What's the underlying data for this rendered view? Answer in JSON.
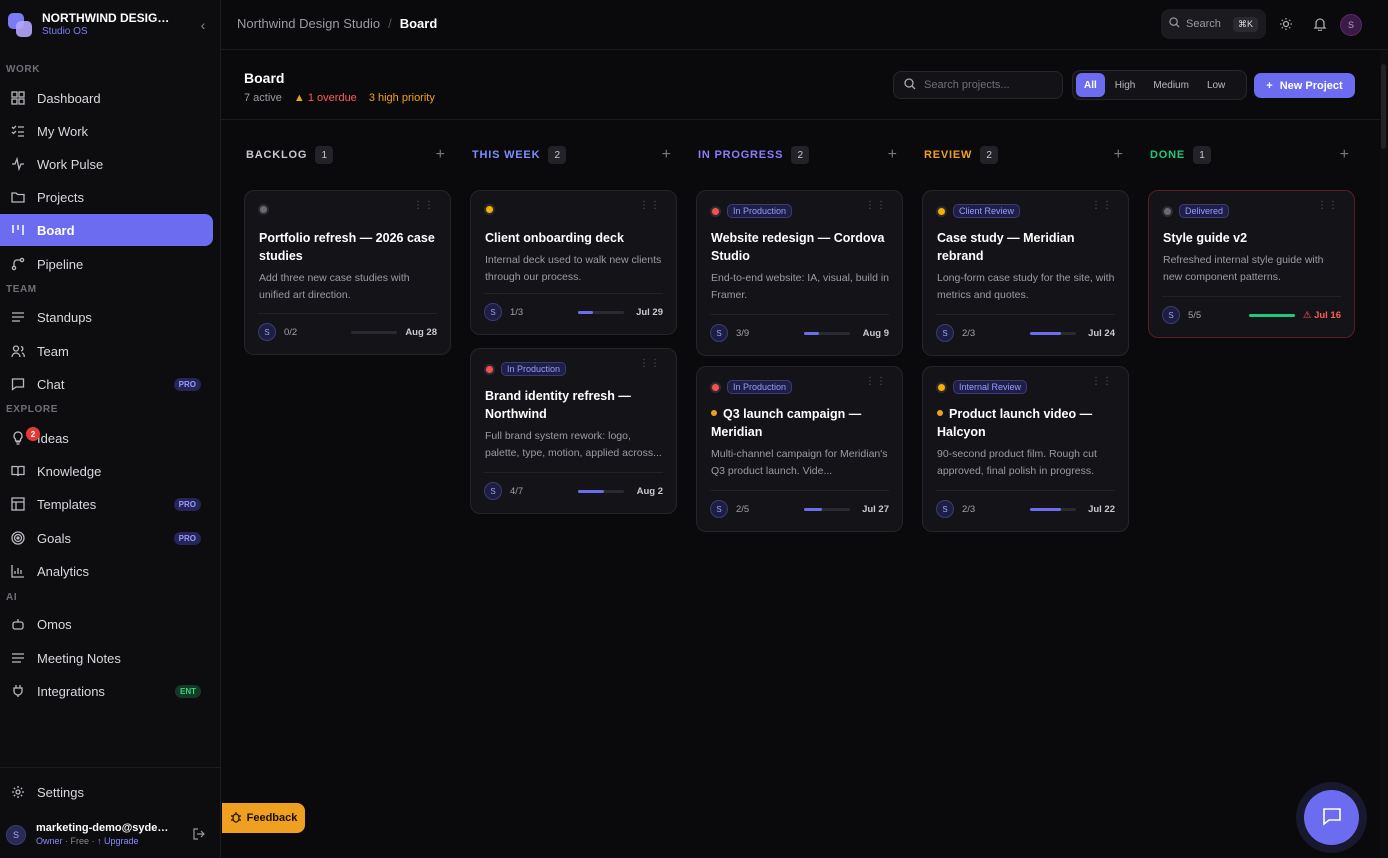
{
  "brand": {
    "name": "NORTHWIND DESIGN S...",
    "sub": "Studio OS"
  },
  "sidebar": {
    "sections": {
      "work": "WORK",
      "team": "TEAM",
      "explore": "EXPLORE",
      "ai": "AI"
    },
    "items": [
      {
        "label": "Dashboard",
        "icon": "grid-icon"
      },
      {
        "label": "My Work",
        "icon": "list-check-icon"
      },
      {
        "label": "Work Pulse",
        "icon": "pulse-icon"
      },
      {
        "label": "Projects",
        "icon": "folder-icon"
      },
      {
        "label": "Board",
        "icon": "board-icon",
        "active": true
      },
      {
        "label": "Pipeline",
        "icon": "pipeline-icon"
      },
      {
        "label": "Standups",
        "icon": "lines-icon"
      },
      {
        "label": "Team",
        "icon": "users-icon"
      },
      {
        "label": "Chat",
        "icon": "chat-icon",
        "tag": "PRO"
      },
      {
        "label": "Ideas",
        "icon": "bulb-icon",
        "badge": "2"
      },
      {
        "label": "Knowledge",
        "icon": "book-icon"
      },
      {
        "label": "Templates",
        "icon": "template-icon",
        "tag": "PRO"
      },
      {
        "label": "Goals",
        "icon": "target-icon",
        "tag": "PRO"
      },
      {
        "label": "Analytics",
        "icon": "chart-icon"
      },
      {
        "label": "Omos",
        "icon": "bot-icon"
      },
      {
        "label": "Meeting Notes",
        "icon": "notes-icon"
      },
      {
        "label": "Integrations",
        "icon": "plug-icon",
        "tag": "ENT"
      },
      {
        "label": "Settings",
        "icon": "gear-icon"
      }
    ]
  },
  "user": {
    "email": "marketing-demo@sydenc...",
    "role": "Owner",
    "plan": "Free",
    "upgrade": "↑ Upgrade",
    "avatar": "S"
  },
  "feedback": "Feedback",
  "topbar": {
    "crumb_parent": "Northwind Design Studio",
    "crumb_sep": "/",
    "crumb_current": "Board",
    "search": "Search",
    "shortcut": "⌘K",
    "avatar": "S"
  },
  "header": {
    "title": "Board",
    "active": "7 active",
    "overdue": "1 overdue",
    "high_priority": "3 high priority",
    "search_placeholder": "Search projects...",
    "filters": [
      "All",
      "High",
      "Medium",
      "Low"
    ],
    "new_project": "New Project"
  },
  "colors": {
    "accent": "#6c6cf0",
    "backlog": "#c8c8d0",
    "this_week": "#7b8cff",
    "in_progress": "#8a7cff",
    "review": "#f0a020",
    "done": "#22c87a",
    "priority_high": "#ff4d4d",
    "priority_medium": "#f5b000",
    "priority_none": "#6a6a72"
  },
  "columns": [
    {
      "title": "BACKLOG",
      "count": "1",
      "color": "#c8c8d0",
      "cards": [
        {
          "title": "Portfolio refresh — 2026 case studies",
          "desc": "Add three new case studies with unified art direction.",
          "tasks": "0/2",
          "progress": 0,
          "date": "Aug 28",
          "priority": "none"
        }
      ]
    },
    {
      "title": "THIS WEEK",
      "count": "2",
      "color": "#7b8cff",
      "cards": [
        {
          "title": "Client onboarding deck",
          "desc": "Internal deck used to walk new clients through our process.",
          "tasks": "1/3",
          "progress": 0.33,
          "date": "Jul 29",
          "priority": "medium"
        },
        {
          "title": "Brand identity refresh — Northwind",
          "tag": "In Production",
          "desc": "Full brand system rework: logo, palette, type, motion, applied across...",
          "tasks": "4/7",
          "progress": 0.57,
          "date": "Aug 2",
          "priority": "high"
        }
      ]
    },
    {
      "title": "IN PROGRESS",
      "count": "2",
      "color": "#8a7cff",
      "cards": [
        {
          "title": "Website redesign — Cordova Studio",
          "tag": "In Production",
          "desc": "End-to-end website: IA, visual, build in Framer.",
          "tasks": "3/9",
          "progress": 0.33,
          "date": "Aug 9",
          "priority": "high"
        },
        {
          "title": "Q3 launch campaign — Meridian",
          "tag": "In Production",
          "desc": "Multi-channel campaign for Meridian's Q3 product launch. Vide...",
          "tasks": "2/5",
          "progress": 0.4,
          "date": "Jul 27",
          "priority": "high",
          "title_dot": true
        }
      ]
    },
    {
      "title": "REVIEW",
      "count": "2",
      "color": "#f0a020",
      "cards": [
        {
          "title": "Case study — Meridian rebrand",
          "tag": "Client Review",
          "desc": "Long-form case study for the site, with metrics and quotes.",
          "tasks": "2/3",
          "progress": 0.67,
          "date": "Jul 24",
          "priority": "medium"
        },
        {
          "title": "Product launch video — Halcyon",
          "tag": "Internal Review",
          "desc": "90-second product film. Rough cut approved, final polish in progress.",
          "tasks": "2/3",
          "progress": 0.67,
          "date": "Jul 22",
          "priority": "medium",
          "title_dot": true
        }
      ]
    },
    {
      "title": "DONE",
      "count": "1",
      "color": "#22c87a",
      "cards": [
        {
          "title": "Style guide v2",
          "tag": "Delivered",
          "desc": "Refreshed internal style guide with new component patterns.",
          "tasks": "5/5",
          "progress": 1,
          "date": "Jul 16",
          "priority": "none",
          "late": true
        }
      ]
    }
  ]
}
